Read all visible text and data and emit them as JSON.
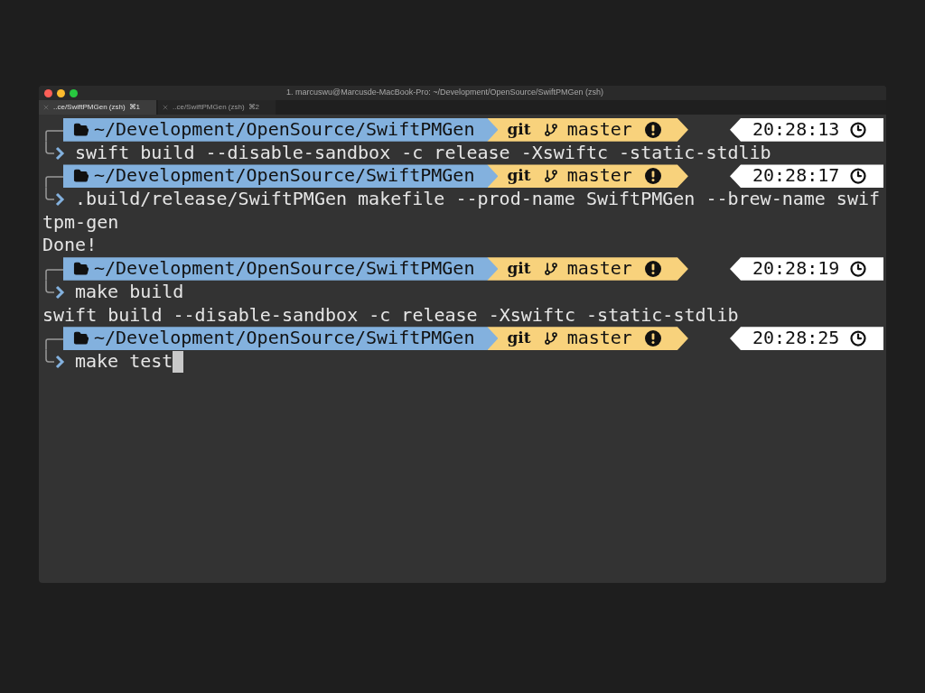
{
  "window": {
    "title": "1. marcuswu@Marcusde-MacBook-Pro: ~/Development/OpenSource/SwiftPMGen (zsh)"
  },
  "tabs": [
    {
      "label": "..ce/SwiftPMGen (zsh)",
      "shortcut": "⌘1",
      "selected": true
    },
    {
      "label": "..ce/SwiftPMGen (zsh)",
      "shortcut": "⌘2",
      "selected": false
    }
  ],
  "lines": [
    {
      "kind": "prompt",
      "path": "~/Development/OpenSource/SwiftPMGen",
      "vcs": "git",
      "branch": "master",
      "time": "20:28:13"
    },
    {
      "kind": "command",
      "text": "swift build --disable-sandbox -c release -Xswiftc -static-stdlib",
      "cursor": false
    },
    {
      "kind": "prompt",
      "path": "~/Development/OpenSource/SwiftPMGen",
      "vcs": "git",
      "branch": "master",
      "time": "20:28:17"
    },
    {
      "kind": "command",
      "text": ".build/release/SwiftPMGen makefile --prod-name SwiftPMGen --brew-name swif",
      "cursor": false
    },
    {
      "kind": "output",
      "text": "tpm-gen"
    },
    {
      "kind": "output",
      "text": "Done!"
    },
    {
      "kind": "prompt",
      "path": "~/Development/OpenSource/SwiftPMGen",
      "vcs": "git",
      "branch": "master",
      "time": "20:28:19"
    },
    {
      "kind": "command",
      "text": "make build",
      "cursor": false
    },
    {
      "kind": "output",
      "text": "swift build --disable-sandbox -c release -Xswiftc -static-stdlib"
    },
    {
      "kind": "prompt",
      "path": "~/Development/OpenSource/SwiftPMGen",
      "vcs": "git",
      "branch": "master",
      "time": "20:28:25"
    },
    {
      "kind": "command",
      "text": "make test",
      "cursor": true
    }
  ]
}
